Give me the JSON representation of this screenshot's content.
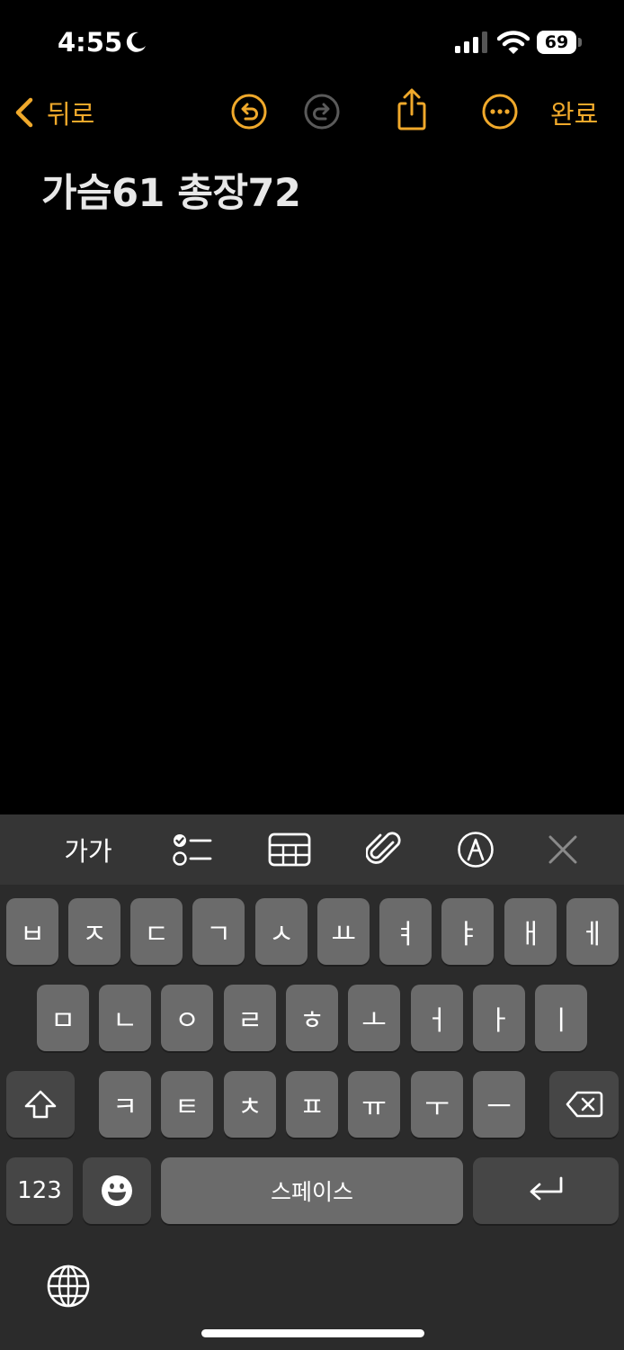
{
  "status_bar": {
    "time": "4:55",
    "battery": "69"
  },
  "nav": {
    "back_label": "뒤로",
    "done_label": "완료"
  },
  "note": {
    "title": "가슴61 총장72"
  },
  "toolbar": {
    "text_format": "가가"
  },
  "keyboard": {
    "row1": [
      "ㅂ",
      "ㅈ",
      "ㄷ",
      "ㄱ",
      "ㅅ",
      "ㅛ",
      "ㅕ",
      "ㅑ",
      "ㅐ",
      "ㅔ"
    ],
    "row2": [
      "ㅁ",
      "ㄴ",
      "ㅇ",
      "ㄹ",
      "ㅎ",
      "ㅗ",
      "ㅓ",
      "ㅏ",
      "ㅣ"
    ],
    "row3": [
      "ㅋ",
      "ㅌ",
      "ㅊ",
      "ㅍ",
      "ㅠ",
      "ㅜ",
      "ㅡ"
    ],
    "numbers_label": "123",
    "space_label": "스페이스"
  },
  "icons": {
    "status": [
      "moon-icon",
      "signal-icon",
      "wifi-icon",
      "battery-icon"
    ],
    "nav": [
      "chevron-left-icon",
      "undo-icon",
      "redo-icon",
      "share-icon",
      "more-icon"
    ],
    "toolbar": [
      "checklist-icon",
      "table-icon",
      "paperclip-icon",
      "markup-pen-icon",
      "close-icon"
    ],
    "keyboard": [
      "shift-icon",
      "backspace-icon",
      "emoji-icon",
      "return-icon",
      "globe-icon"
    ]
  },
  "colors": {
    "accent": "#f0a92b",
    "background": "#000000",
    "keyboard_bg": "#2b2b2b",
    "key": "#6b6b6b",
    "key_dark": "#464646"
  }
}
